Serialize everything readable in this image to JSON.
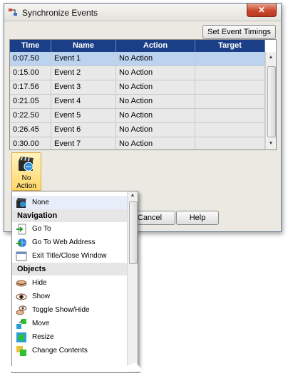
{
  "window": {
    "title": "Synchronize Events",
    "close_label": "✕",
    "set_timings_label": "Set Event Timings"
  },
  "grid": {
    "columns": [
      "Time",
      "Name",
      "Action",
      "Target"
    ],
    "rows": [
      {
        "time": "0:07.50",
        "name": "Event 1",
        "action": "No Action",
        "target": ""
      },
      {
        "time": "0:15.00",
        "name": "Event 2",
        "action": "No Action",
        "target": ""
      },
      {
        "time": "0:17.56",
        "name": "Event 3",
        "action": "No Action",
        "target": ""
      },
      {
        "time": "0:21.05",
        "name": "Event 4",
        "action": "No Action",
        "target": ""
      },
      {
        "time": "0:22.50",
        "name": "Event 5",
        "action": "No Action",
        "target": ""
      },
      {
        "time": "0:26.45",
        "name": "Event 6",
        "action": "No Action",
        "target": ""
      },
      {
        "time": "0:30.00",
        "name": "Event 7",
        "action": "No Action",
        "target": ""
      }
    ],
    "selected_row": 0
  },
  "action_tile": {
    "label_line1": "No",
    "label_line2": "Action"
  },
  "buttons": {
    "cancel": "Cancel",
    "help": "Help"
  },
  "menu": {
    "none": "None",
    "navigation_header": "Navigation",
    "goto": "Go To",
    "goto_web": "Go To Web Address",
    "exit_title": "Exit Title/Close Window",
    "objects_header": "Objects",
    "hide": "Hide",
    "show": "Show",
    "toggle": "Toggle Show/Hide",
    "move": "Move",
    "resize": "Resize",
    "change_contents": "Change Contents"
  },
  "colors": {
    "header": "#1b3f86",
    "selected_row": "#bcd3f0",
    "tile": "#ffd86a"
  }
}
